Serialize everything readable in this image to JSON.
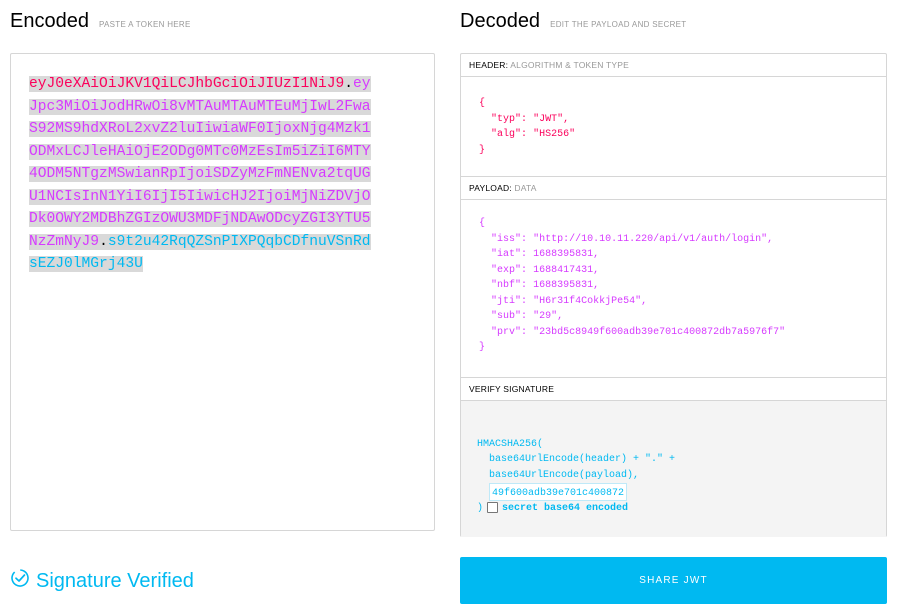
{
  "encoded": {
    "title": "Encoded",
    "subtitle": "PASTE A TOKEN HERE",
    "token_lines": [
      [
        {
          "text": "eyJ0eXAiOiJKV1QiLCJhbGciOiJIUzI1NiJ9",
          "part": "header"
        },
        {
          "text": ".",
          "part": "dot"
        },
        {
          "text": "ey",
          "part": "payload"
        }
      ],
      [
        {
          "text": "Jpc3MiOiJodHRwOi8vMTAuMTAuMTEuMjIwL2Fwa",
          "part": "payload"
        }
      ],
      [
        {
          "text": "S92MS9hdXRoL2xvZ2luIiwiaWF0IjoxNjg4Mzk1",
          "part": "payload"
        }
      ],
      [
        {
          "text": "ODMxLCJleHAiOjE2ODg0MTc0MzEsIm5iZiI6MTY",
          "part": "payload"
        }
      ],
      [
        {
          "text": "4ODM5NTgzMSwianRpIjoiSDZyMzFmNENva2tqUG",
          "part": "payload"
        }
      ],
      [
        {
          "text": "U1NCIsInN1YiI6IjI5IiwicHJ2IjoiMjNiZDVjO",
          "part": "payload"
        }
      ],
      [
        {
          "text": "Dk0OWY2MDBhZGIzOWU3MDFjNDAwODcyZGI3YTU5",
          "part": "payload"
        }
      ],
      [
        {
          "text": "NzZmNyJ9",
          "part": "payload"
        },
        {
          "text": ".",
          "part": "dot"
        },
        {
          "text": "s9t2u42RqQZSnPIXPQqbCDfnuVSnRd",
          "part": "signature"
        }
      ],
      [
        {
          "text": "sEZJ0lMGrj43U",
          "part": "signature"
        }
      ]
    ]
  },
  "decoded": {
    "title": "Decoded",
    "subtitle": "EDIT THE PAYLOAD AND SECRET",
    "header_label": "HEADER:",
    "header_sub": "ALGORITHM & TOKEN TYPE",
    "header_json": [
      {
        "key": "typ",
        "value": "\"JWT\""
      },
      {
        "key": "alg",
        "value": "\"HS256\""
      }
    ],
    "payload_label": "PAYLOAD:",
    "payload_sub": "DATA",
    "payload_json": [
      {
        "key": "iss",
        "value": "\"http://10.10.11.220/api/v1/auth/login\""
      },
      {
        "key": "iat",
        "value": "1688395831"
      },
      {
        "key": "exp",
        "value": "1688417431"
      },
      {
        "key": "nbf",
        "value": "1688395831"
      },
      {
        "key": "jti",
        "value": "\"H6r31f4CokkjPe54\""
      },
      {
        "key": "sub",
        "value": "\"29\""
      },
      {
        "key": "prv",
        "value": "\"23bd5c8949f600adb39e701c400872db7a5976f7\""
      }
    ],
    "verify_label": "VERIFY SIGNATURE",
    "verify": {
      "fn_open": "HMACSHA256(",
      "line1": "  base64UrlEncode(header) + \".\" +",
      "line2": "  base64UrlEncode(payload),",
      "secret_value": "49f600adb39e701c400872",
      "close": ")",
      "checkbox_label": "secret base64 encoded"
    }
  },
  "status": {
    "verified_text": "Signature Verified"
  },
  "share_button": "SHARE JWT",
  "colors": {
    "header": "#fb015b",
    "payload": "#d63aff",
    "signature": "#00b9f1",
    "accent": "#00b9f1"
  }
}
